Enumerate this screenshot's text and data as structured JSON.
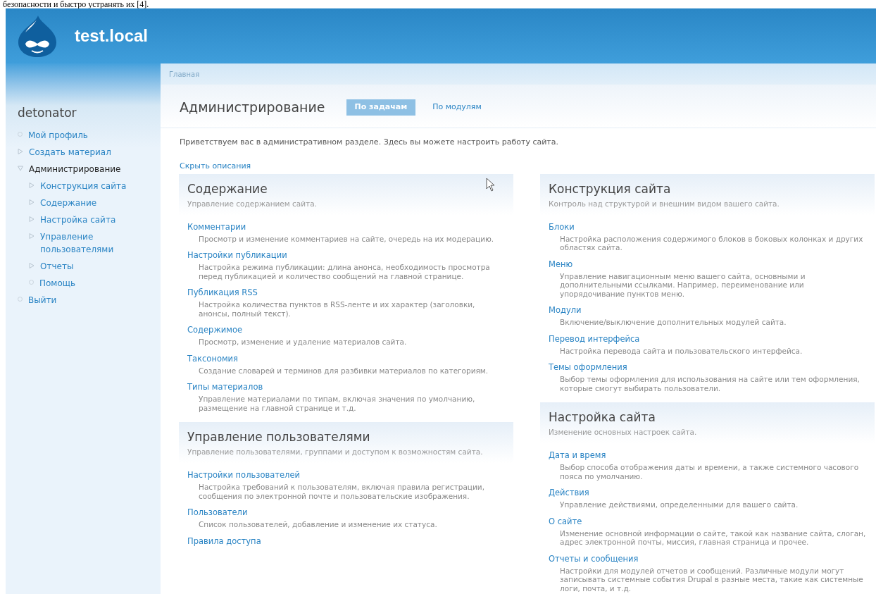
{
  "document_text": "безопасности и быстро устранять их [4].",
  "site": {
    "name": "test.local"
  },
  "breadcrumb": [
    "Главная"
  ],
  "sidebar": {
    "title": "detonator",
    "items": [
      {
        "label": "Мой профиль",
        "kind": "leaf",
        "active": false
      },
      {
        "label": "Создать материал",
        "kind": "folder",
        "expanded": false,
        "active": false
      },
      {
        "label": "Администрирование",
        "kind": "folder",
        "expanded": true,
        "active": true,
        "children": [
          {
            "label": "Конструкция сайта",
            "kind": "folder",
            "expanded": false,
            "active": false
          },
          {
            "label": "Содержание",
            "kind": "folder",
            "expanded": false,
            "active": false
          },
          {
            "label": "Настройка сайта",
            "kind": "folder",
            "expanded": false,
            "active": false
          },
          {
            "label": "Управление пользователями",
            "kind": "folder",
            "expanded": false,
            "active": false
          },
          {
            "label": "Отчеты",
            "kind": "folder",
            "expanded": false,
            "active": false
          },
          {
            "label": "Помощь",
            "kind": "leaf",
            "active": false
          }
        ]
      },
      {
        "label": "Выйти",
        "kind": "leaf",
        "active": false
      }
    ]
  },
  "page": {
    "title": "Администрирование",
    "tabs": [
      {
        "label": "По задачам",
        "selected": true
      },
      {
        "label": "По модулям",
        "selected": false
      }
    ],
    "welcome": "Приветствуем вас в административном разделе. Здесь вы можете настроить работу сайта.",
    "toggle_link": "Скрыть описания"
  },
  "columns": [
    [
      {
        "title": "Содержание",
        "description": "Управление содержанием сайта.",
        "items": [
          {
            "label": "Комментарии",
            "description": "Просмотр и изменение комментариев на сайте, очередь на их модерацию."
          },
          {
            "label": "Настройки публикации",
            "description": "Настройка режима публикации: длина анонса, необходимость просмотра перед публикацией и количество сообщений на главной странице."
          },
          {
            "label": "Публикация RSS",
            "description": "Настройка количества пунктов в RSS-ленте и их характер (заголовки, анонсы, полный текст)."
          },
          {
            "label": "Содержимое",
            "description": "Просмотр, изменение и удаление материалов сайта."
          },
          {
            "label": "Таксономия",
            "description": "Создание словарей и терминов для разбивки материалов по категориям."
          },
          {
            "label": "Типы материалов",
            "description": "Управление материалами по типам, включая значения по умолчанию, размещение на главной странице и т.д."
          }
        ]
      },
      {
        "title": "Управление пользователями",
        "description": "Управление пользователями, группами и доступом к возможностям сайта.",
        "items": [
          {
            "label": "Настройки пользователей",
            "description": "Настройка требований к пользователям, включая правила регистрации, сообщения по электронной почте и пользовательские изображения."
          },
          {
            "label": "Пользователи",
            "description": "Список пользователей, добавление и изменение их статуса."
          },
          {
            "label": "Правила доступа"
          }
        ]
      }
    ],
    [
      {
        "title": "Конструкция сайта",
        "description": "Контроль над структурой и внешним видом вашего сайта.",
        "items": [
          {
            "label": "Блоки",
            "description": "Настройка расположения содержимого блоков в боковых колонках и других областях сайта."
          },
          {
            "label": "Меню",
            "description": "Управление навигационным меню вашего сайта, основными и дополнительными ссылками. Например, переименование или упорядочивание пунктов меню."
          },
          {
            "label": "Модули",
            "description": "Включение/выключение дополнительных модулей сайта."
          },
          {
            "label": "Перевод интерфейса",
            "description": "Настройка перевода сайта и пользовательского интерфейса."
          },
          {
            "label": "Темы оформления",
            "description": "Выбор темы оформления для использования на сайте или тем оформления, которые смогут выбирать пользователи."
          }
        ]
      },
      {
        "title": "Настройка сайта",
        "description": "Изменение основных настроек сайта.",
        "items": [
          {
            "label": "Дата и время",
            "description": "Выбор способа отображения даты и времени, а также системного часового пояса по умолчанию."
          },
          {
            "label": "Действия",
            "description": "Управление действиями, определенными для вашего сайта."
          },
          {
            "label": "О сайте",
            "description": "Изменение основной информации о сайте, такой как название сайта, слоган, адрес электронной почты, миссия, главная страница и прочее."
          },
          {
            "label": "Отчеты и сообщения",
            "description": "Настройки для модулей отчетов и сообщений. Различные модули могут записывать системные события Drupal в разные места, такие как системные логи, почта, и т.д."
          }
        ]
      }
    ]
  ]
}
